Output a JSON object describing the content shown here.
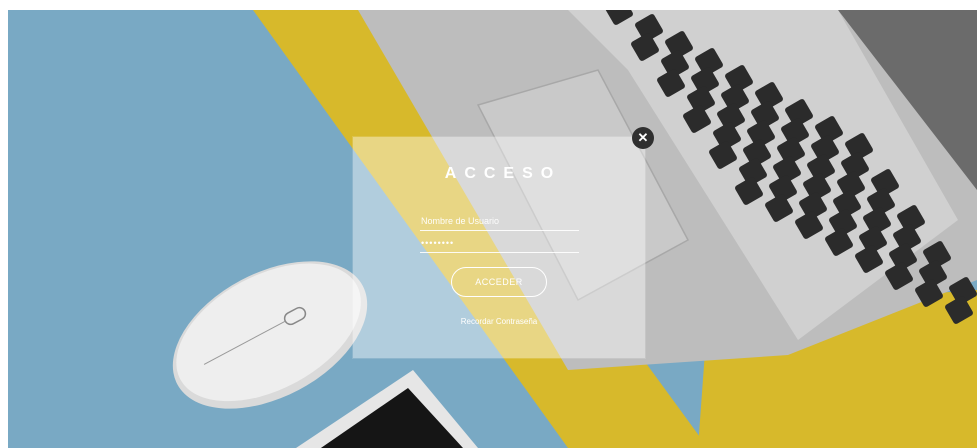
{
  "login": {
    "title": "ACCESO",
    "username_placeholder": "Nombre de Usuario",
    "password_value": "••••••••",
    "submit_label": "ACCEDER",
    "forgot_label": "Recordar Contraseña",
    "close_glyph": "✕"
  },
  "background": {
    "colors": {
      "blue": "#79a9c4",
      "yellow": "#d7b92b",
      "laptop": "#b9b9b9",
      "keyboard": "#2b2b2b",
      "mouse": "#dcdcdc",
      "tablet": "#e9e9e9"
    }
  },
  "icons": {
    "close": "close-icon"
  }
}
